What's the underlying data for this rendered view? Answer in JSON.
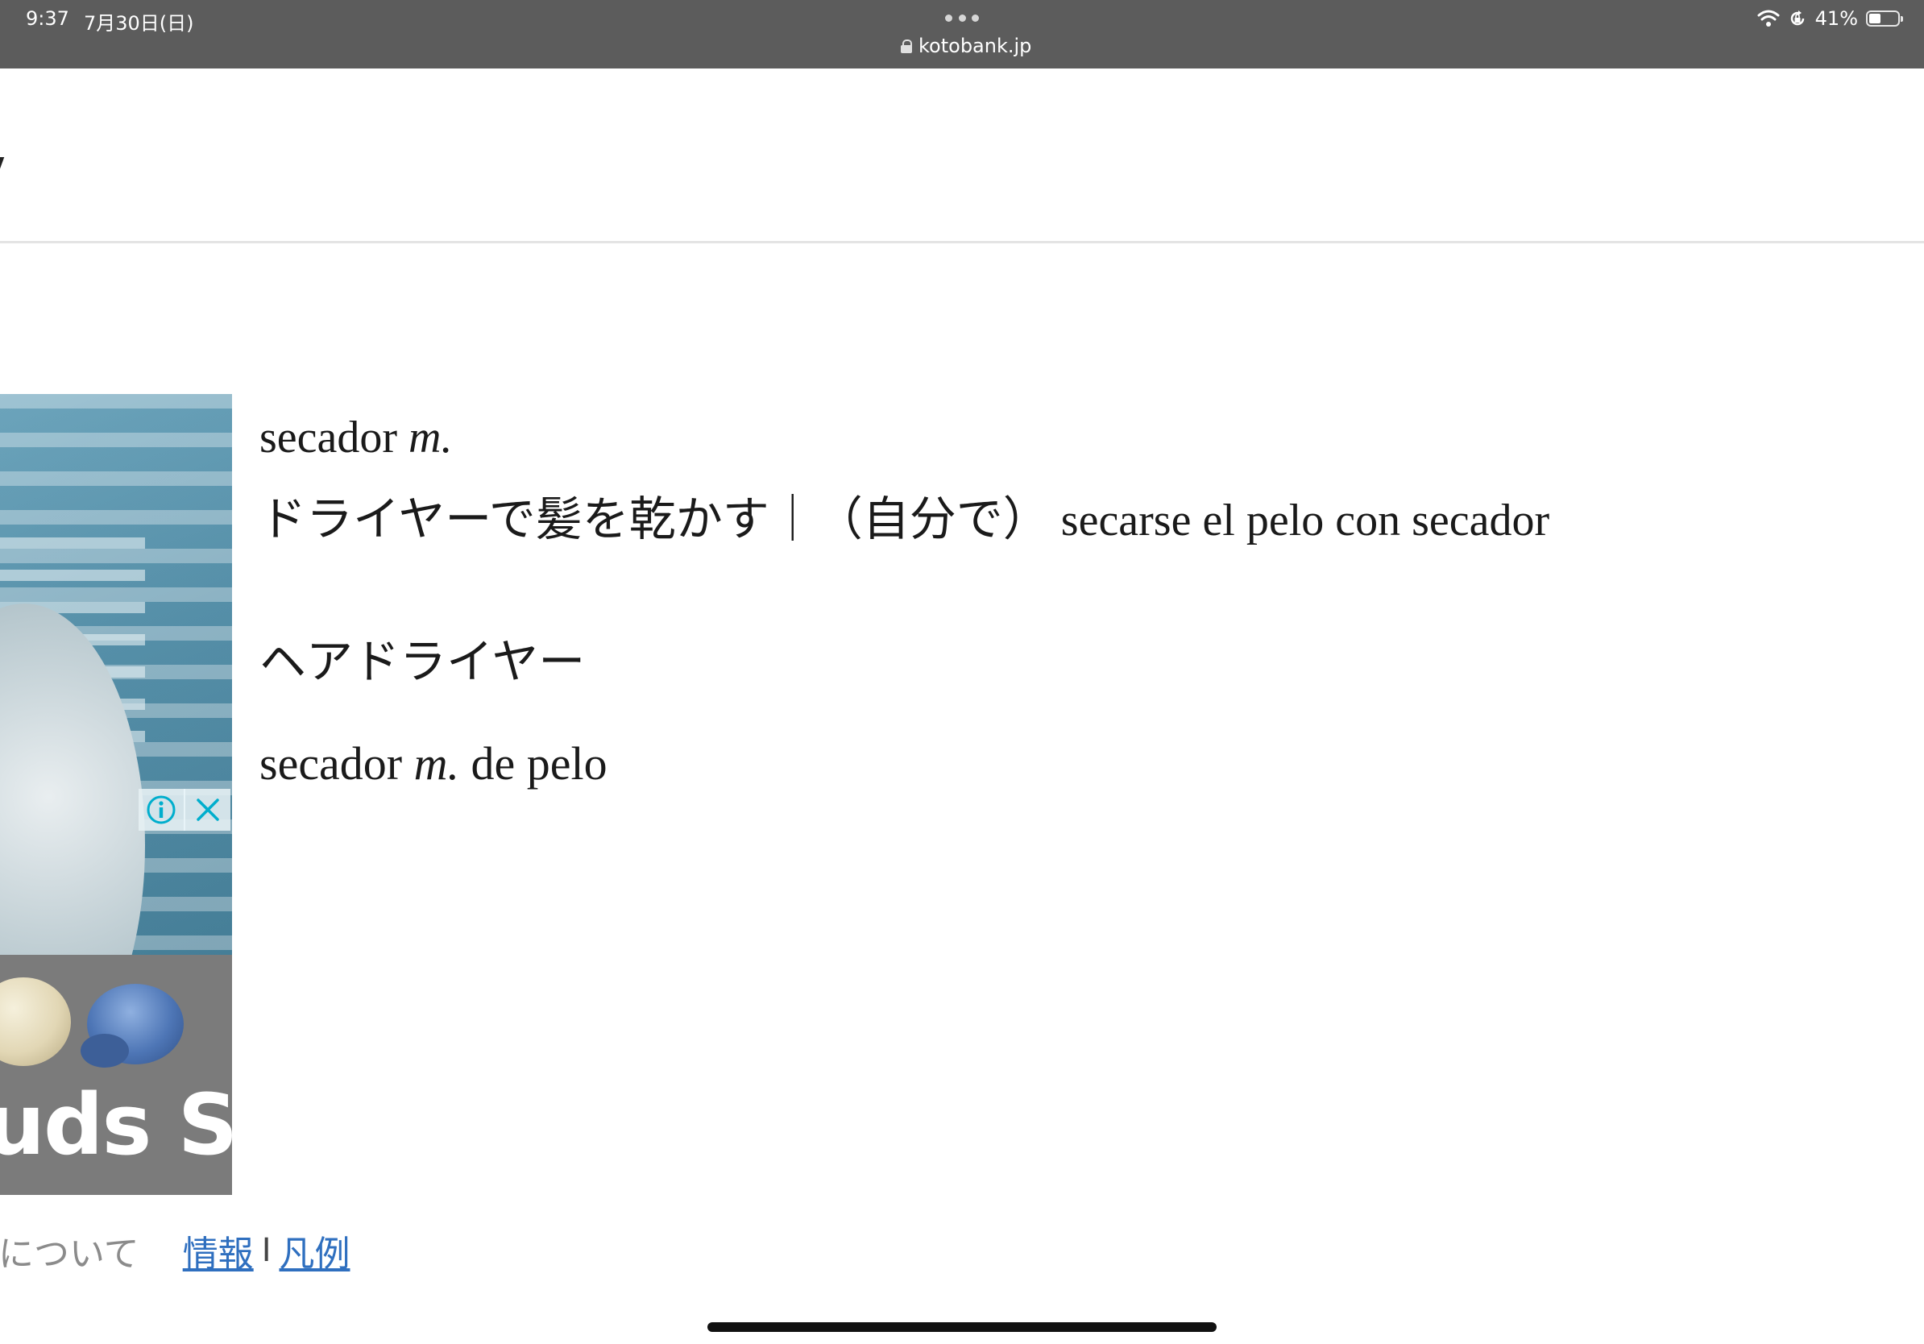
{
  "status_bar": {
    "time": "9:37",
    "date": "7月30日(日)",
    "url": "kotobank.jp",
    "battery": "41%",
    "battery_level": 0.41
  },
  "ad": {
    "brand_text": "uds S"
  },
  "entry": {
    "line1_word": "secador ",
    "line1_gender": "m.",
    "line2_ja": "ドライヤーで髪を乾かす｜（自分で）",
    "line2_es": "secarse el pelo con secador",
    "heading": "ヘアドライヤー",
    "line3_word": "secador ",
    "line3_gender": "m.",
    "line3_rest": " de pelo"
  },
  "footer": {
    "about_fragment": "について",
    "link_info": "情報",
    "separator": "I",
    "link_legend": "凡例"
  },
  "colors": {
    "status_bar": "#5c5c5c",
    "link": "#2f6fbf",
    "ad_info_icon": "#00aecd"
  }
}
